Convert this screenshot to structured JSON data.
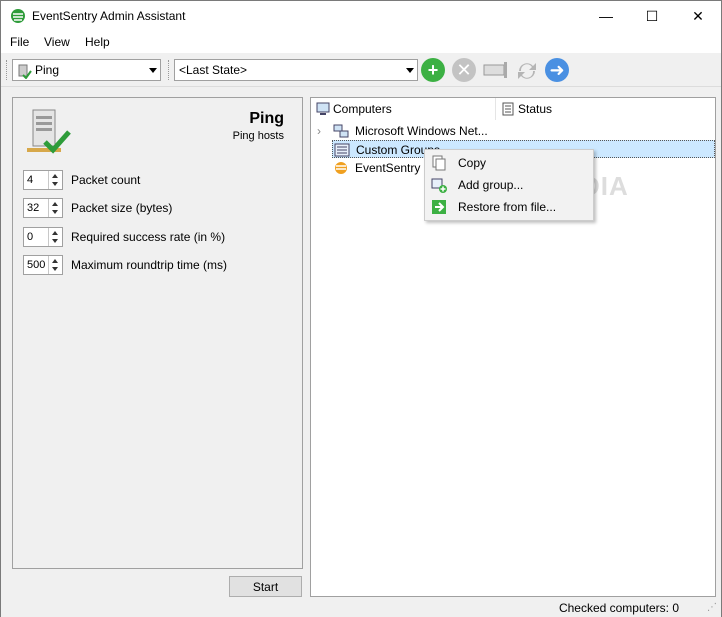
{
  "window": {
    "title": "EventSentry Admin Assistant",
    "minimize": "—",
    "maximize": "☐",
    "close": "✕"
  },
  "menu": {
    "items": [
      "File",
      "View",
      "Help"
    ]
  },
  "toolbar": {
    "action_combo": "Ping",
    "state_combo": "<Last State>",
    "icons": [
      "add-icon",
      "remove-icon",
      "config-icon",
      "refresh-icon",
      "forward-icon"
    ]
  },
  "left": {
    "title": "Ping",
    "subtitle": "Ping hosts",
    "fields": [
      {
        "value": "4",
        "label": "Packet count"
      },
      {
        "value": "32",
        "label": "Packet size (bytes)"
      },
      {
        "value": "0",
        "label": "Required success rate (in %)"
      },
      {
        "value": "500",
        "label": "Maximum roundtrip time (ms)"
      }
    ],
    "start": "Start"
  },
  "right": {
    "columns": [
      "Computers",
      "Status"
    ],
    "tree": [
      {
        "label": "Microsoft Windows Net..."
      },
      {
        "label": "Custom Groups"
      },
      {
        "label": "EventSentry ("
      }
    ]
  },
  "context_menu": {
    "items": [
      "Copy",
      "Add group...",
      "Restore from file..."
    ]
  },
  "status": {
    "text": "Checked computers: 0"
  },
  "watermark": "SOFTPEDIA",
  "colors": {
    "selection": "#cce8ff",
    "add_green": "#3cb043",
    "remove_gray": "#b0b0b0",
    "forward_blue": "#4a90e2"
  }
}
